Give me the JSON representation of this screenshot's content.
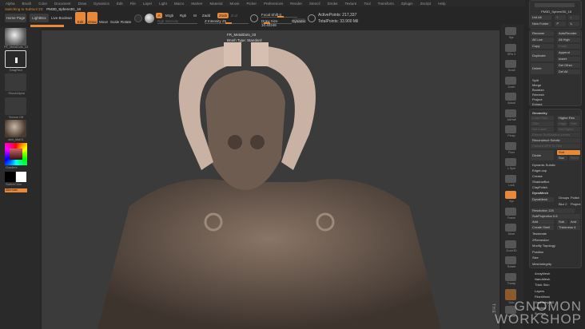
{
  "menu": [
    "Alpha",
    "Brush",
    "Color",
    "Document",
    "Draw",
    "Dynamics",
    "Edit",
    "File",
    "Layer",
    "Light",
    "Macro",
    "Marker",
    "Material",
    "Movie",
    "Picker",
    "Preferences",
    "Render",
    "Stencil",
    "Stroke",
    "Texture",
    "Tool",
    "Transform",
    "Zplugin",
    "Zscript",
    "Help"
  ],
  "status": {
    "message": "Switching to Subtool 23:",
    "subtool": "PM3D_Sphere3D_18"
  },
  "toolbar": {
    "home": "Home Page",
    "lightbox": "LightBox",
    "live_boolean": "Live Boolean",
    "edit": "Edit",
    "draw": "Draw",
    "move": "Move",
    "scale": "Scale",
    "rotate": "Rotate",
    "a": "A",
    "mrgb": "Mrgb",
    "rgb": "Rgb",
    "m": "M",
    "rgb_intensity": "Rgb Intensity",
    "zadd": "Zadd",
    "zsub": "Zsub",
    "zcut": "Zcut",
    "z_intensity": "Z Intensity 25",
    "focal_shift": "Focal Shift 0",
    "draw_size": "Draw Size 10.40248",
    "dynamic": "Dynamic",
    "active_points": "ActivePoints: 217,337",
    "total_points": "TotalPoints: 33.900 Mil"
  },
  "left": {
    "brush": "FR_MetalDots_03",
    "stroke": "DragRect",
    "alpha": "~BrushAlpha",
    "texture": "Texture Off",
    "material": "skin_Mat01",
    "gradient": "Gradient",
    "switch": "SwitchColor",
    "alternate": "Alternate"
  },
  "canvas": {
    "brush_name": "FR_MetalDots_03",
    "brush_type": "Brush Type: Standard"
  },
  "icons": [
    "Bpr",
    "SPix 3",
    "Scroll",
    "Zoom",
    "Actual",
    "AAHalf",
    "Persp",
    "Floor",
    "L.Sym",
    "Lock",
    "Xyz",
    "Frame",
    "Move",
    "Zoom3D",
    "Rotate",
    "Transp",
    "Solo",
    "Xpose"
  ],
  "subtool": {
    "name": "PM3D_Sphere3D_18",
    "list_all": "List All",
    "new_folder": "New Folder"
  },
  "subtool_ops": {
    "rename": "Rename",
    "autoreorder": "AutoReorder",
    "all_low": "All Low",
    "all_high": "All High",
    "copy": "Copy",
    "paste": "Paste",
    "duplicate": "Duplicate",
    "append": "Append",
    "insert": "Insert",
    "delete": "Delete",
    "del_other": "Del Other",
    "del_all": "Del All",
    "split": "Split",
    "merge": "Merge",
    "boolean": "Boolean",
    "remesh": "Remesh",
    "project": "Project",
    "extract": "Extract"
  },
  "geometry": {
    "title": "Geometry",
    "lower_res": "Lower Res",
    "higher_res": "Higher Res",
    "sdiv": "SDiv",
    "cage": "Cage",
    "rstr": "Rstr",
    "del_lower": "Del Lower",
    "del_higher": "Del Higher",
    "freeze": "Freeze SubDivision Levels",
    "reconstruct": "Reconstruct Subdiv",
    "convert_bpr": "Convert BPR To Geo",
    "divide": "Divide",
    "smt": "Smt",
    "suv": "Suv",
    "reuv": "ReUV",
    "dynamic_subdiv": "Dynamic Subdiv",
    "edgeloop": "EdgeLoop",
    "crease": "Crease",
    "shadowbox": "ShadowBox",
    "claypolish": "ClayPolish",
    "dynamesh_title": "DynaMesh",
    "dynamesh": "DynaMesh",
    "groups": "Groups",
    "polish": "Polish",
    "blur": "Blur 2",
    "project": "Project",
    "resolution": "Resolution 128",
    "subprojection": "SubProjection 0.6",
    "add": "Add",
    "sub": "Sub",
    "and": "And",
    "create_shell": "Create Shell",
    "thickness": "Thickness 4",
    "tessimate": "Tessimate",
    "zremesher": "ZRemesher",
    "modify_topology": "Modify Topology",
    "position": "Position",
    "size": "Size",
    "meshintegrity": "MeshIntegrity"
  },
  "more": [
    "ArrayMesh",
    "NanoMesh",
    "Thick Skin",
    "Layers",
    "FiberMesh",
    "Geometry HD",
    "Preview",
    "Surface"
  ],
  "watermark": {
    "the": "THE",
    "line1": "GNOMON",
    "line2": "WORKSHOP"
  },
  "colors": {
    "accent": "#e8893a"
  }
}
